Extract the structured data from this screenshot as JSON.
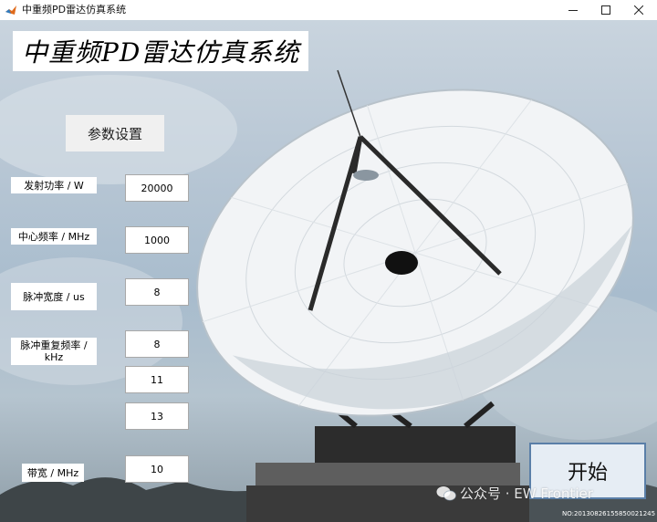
{
  "window": {
    "title": "中重频PD雷达仿真系统",
    "icon": "matlab-app-icon",
    "controls": [
      "minimize-icon",
      "maximize-icon",
      "close-icon"
    ]
  },
  "main_title": "中重频PD雷达仿真系统",
  "section_label": "参数设置",
  "params": {
    "power": {
      "label": "发射功率 / W",
      "value": "20000"
    },
    "center_freq": {
      "label": "中心频率 / MHz",
      "value": "1000"
    },
    "pulse_width": {
      "label": "脉冲宽度 / us",
      "value": "8"
    },
    "prf": {
      "label": "脉冲重复频率 / kHz",
      "values": [
        "8",
        "11",
        "13"
      ]
    },
    "bandwidth": {
      "label": "带宽 / MHz",
      "value": "10"
    }
  },
  "start_label": "开始",
  "watermark": "公众号 · EW Frontier",
  "stamp": "NO:20130826155850021245",
  "colors": {
    "start_border": "#5a7fa8",
    "start_bg": "#e6edf4",
    "section_bg": "#f0f0f0"
  }
}
